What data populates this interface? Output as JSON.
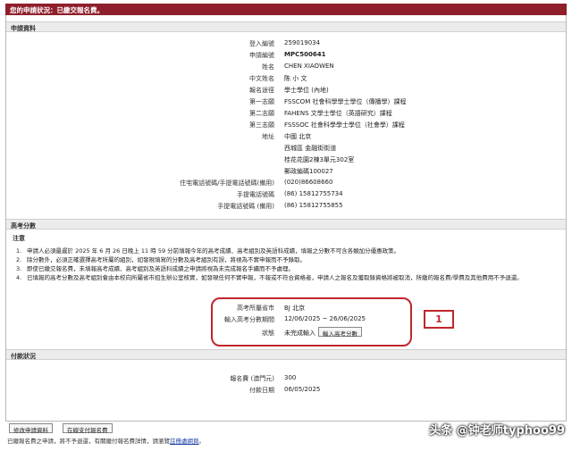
{
  "status_bar": "您的申請狀況：已繳交報名費。",
  "application_section": {
    "title": "申請資料",
    "rows": [
      {
        "label": "登入編號",
        "value": "259019034"
      },
      {
        "label": "申請編號",
        "value": "MPC500641"
      },
      {
        "label": "姓名",
        "value": "CHEN XIAOWEN"
      },
      {
        "label": "中文姓名",
        "value": "陈 小 文"
      },
      {
        "label": "報名途徑",
        "value": "學士學位 (內地)"
      },
      {
        "label": "第一志願",
        "value": "FSSCOM 社會科學學士學位（傳播學）課程"
      },
      {
        "label": "第二志願",
        "value": "FAHENS 文學士學位（英語研究）課程"
      },
      {
        "label": "第三志願",
        "value": "FSSSOC 社會科學學士學位（社會學）課程"
      },
      {
        "label": "地址",
        "value": "中國 北京"
      },
      {
        "label": "",
        "value": "西城區 金融街街道"
      },
      {
        "label": "",
        "value": "桂花花園2棟3單元302室"
      },
      {
        "label": "",
        "value": "郵政編碼100027"
      },
      {
        "label": "住宅電話號碼/手提電話號碼(備用)",
        "value": "(020)86608660"
      },
      {
        "label": "手提電話號碼",
        "value": "(86)  15812755734"
      },
      {
        "label": "手提電話號碼 (備用)",
        "value": "(86)  15812755855"
      }
    ]
  },
  "gaokao_section": {
    "title": "高考分數",
    "notes_title": "注意",
    "notes": [
      "申請人必須最遲於 2025 年 6 月 26 日晚上 11 時 59 分前填報今年的高考成績、高考組別及英語科成績，填報之分數不可含各類加分優惠政策。",
      "除分數外，必須正確選擇高考所屬的組別，如發現填寫的分數及高考組別有誤，將視為不實申報而不予錄取。",
      "即使已繳交報名費，未填報高考成績、高考組別及英語科成績之申請將視為未完成報名手續而不予處理。",
      "已填報的高考分數及高考組別會由本校向所屬省市招生辦公室核實，如發現任何不實申報，不報或不符合資格者，申請人之報名及獲取錄資格將被取消，所繳的報名費/學費及其他費用不予退還。"
    ],
    "fields": {
      "province_label": "高考所屬省市",
      "province_value": "BJ 北京",
      "period_label": "輸入高考分數期間",
      "period_value": "12/06/2025 ~ 26/06/2025",
      "status_label": "狀態",
      "status_value": "未完成輸入",
      "input_button": "輸入高考分數"
    },
    "callout": "1"
  },
  "payment_section": {
    "title": "付款狀況",
    "rows": [
      {
        "label": "報名費 (澳門元)",
        "value": "300"
      },
      {
        "label": "付款日期",
        "value": "06/05/2025"
      }
    ]
  },
  "buttons": {
    "edit": "修改申請資料",
    "pay_online": "在線支付報名費"
  },
  "footer": {
    "note": "已繳報名費之申請，將不予退還，有關繳付報名費詳情，請瀏覽",
    "link": "註冊處網頁"
  },
  "watermark": "头条 @钟老师typhoo99",
  "colors": {
    "accent": "#8f1f2b",
    "highlight": "#c0262d",
    "status_red": "#d20000"
  }
}
